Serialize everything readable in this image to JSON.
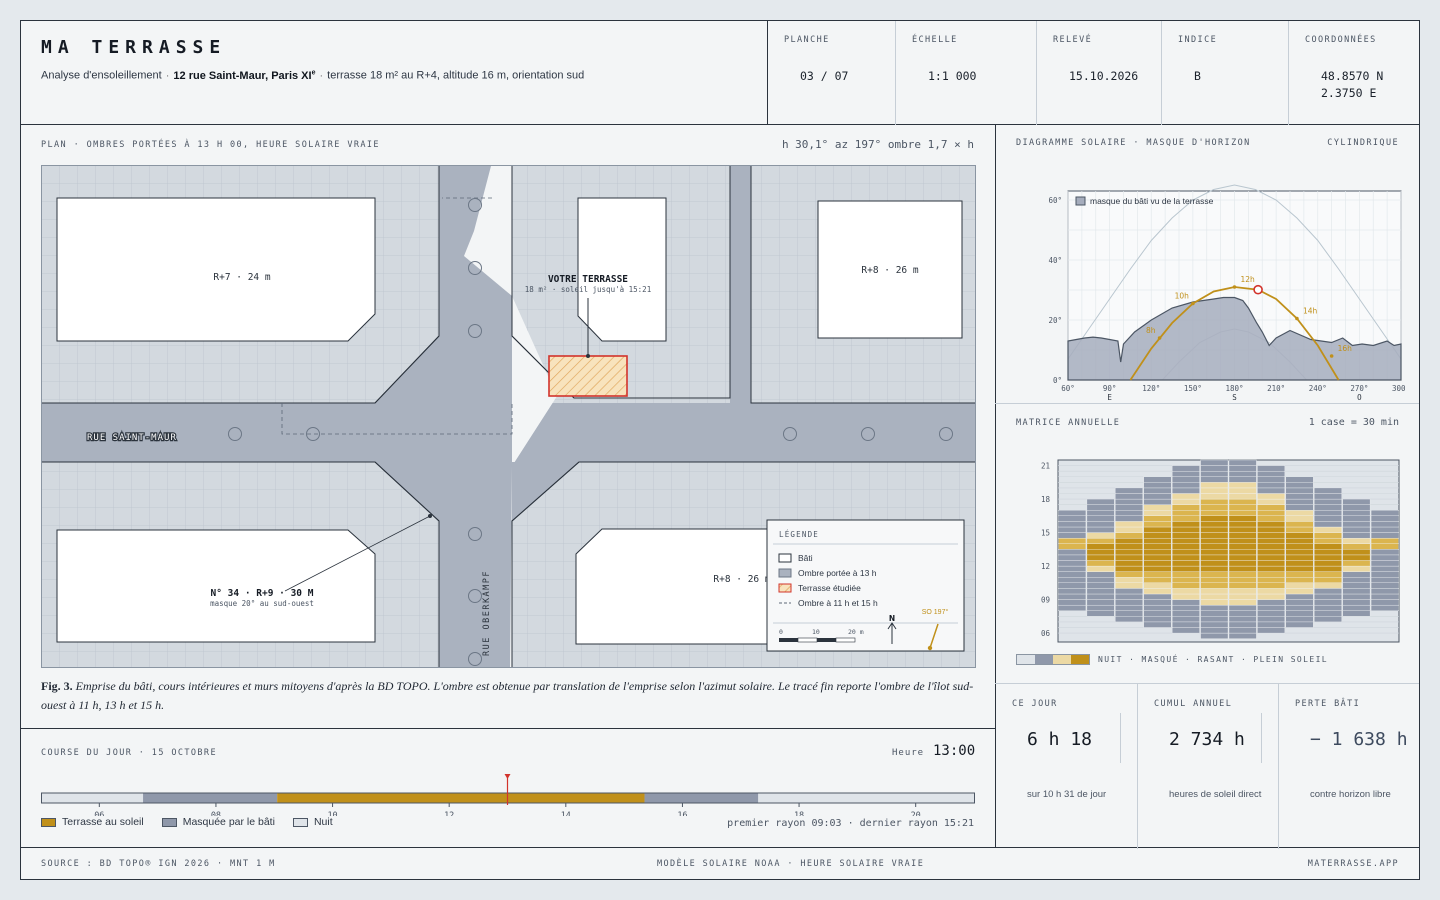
{
  "header": {
    "title": "MA TERRASSE",
    "subtitle_prefix": "Analyse d'ensoleillement",
    "address": "12 rue Saint-Maur, Paris XI",
    "address_sup": "e",
    "subtitle_suffix": "terrasse 18 m² au R+4, altitude 16 m, orientation sud",
    "meta": [
      {
        "label": "PLANCHE",
        "value": "03 / 07"
      },
      {
        "label": "ÉCHELLE",
        "value": "1:1 000"
      },
      {
        "label": "RELEVÉ",
        "value": "15.10.2026"
      },
      {
        "label": "INDICE",
        "value": "B"
      },
      {
        "label": "COORDONNÉES",
        "value": "48.8570 N\n2.3750 E"
      }
    ]
  },
  "plan": {
    "caption": "PLAN · OMBRES PORTÉES À 13 H 00, HEURE SOLAIRE VRAIE",
    "sun_readout": "h 30,1° az 197° ombre 1,7 × h",
    "street_h": "RUE SAINT-MAUR",
    "street_v": "RUE OBERKAMPF",
    "buildings": {
      "nw": "R+7 · 24 m",
      "ne": "R+8 · 26 m",
      "se": "R+8 · 26 m",
      "sw_title": "N° 34 · R+9 · 30 M",
      "sw_sub": "masque 20° au sud-ouest"
    },
    "terrace_title": "VOTRE TERRASSE",
    "terrace_sub": "18 m² · soleil jusqu'à 15:21",
    "legend": {
      "title": "LÉGENDE",
      "items": [
        "Bâti",
        "Ombre portée à 13 h",
        "Terrasse étudiée",
        "Ombre à 11 h et 15 h"
      ],
      "scale_ticks": [
        "0",
        "10",
        "20 m"
      ],
      "north": "N",
      "sun_dir": "SO 197°"
    },
    "fig_label": "Fig. 3.",
    "fig_text": "Emprise du bâti, cours intérieures et murs mitoyens d'après la BD TOPO. L'ombre est obtenue par translation de l'emprise selon l'azimut solaire. Le tracé fin reporte l'ombre de l'îlot sud-ouest à 11 h, 13 h et 15 h."
  },
  "course": {
    "caption": "COURSE DU JOUR · 15 OCTOBRE",
    "heure_label": "Heure",
    "heure_value": "13:00",
    "ticks": [
      "06",
      "08",
      "10",
      "12",
      "14",
      "16",
      "18",
      "20"
    ],
    "hour_range": [
      5,
      21
    ],
    "segments": [
      {
        "from": 5.0,
        "to": 6.75,
        "state": "nuit"
      },
      {
        "from": 6.75,
        "to": 9.05,
        "state": "masque"
      },
      {
        "from": 9.05,
        "to": 15.35,
        "state": "soleil"
      },
      {
        "from": 15.35,
        "to": 17.3,
        "state": "masque"
      },
      {
        "from": 17.3,
        "to": 21.0,
        "state": "nuit"
      }
    ],
    "cursor_hour": 13,
    "legend": [
      "Terrasse au soleil",
      "Masquée par le bâti",
      "Nuit"
    ],
    "rays": "premier rayon 09:03 · dernier rayon 15:21"
  },
  "solar": {
    "caption": "DIAGRAMME SOLAIRE · MASQUE D'HORIZON",
    "projection": "CYLINDRIQUE",
    "legend": "masque du bâti vu de la terrasse",
    "x_ticks": [
      "60°",
      "90°",
      "120°",
      "150°",
      "180°",
      "210°",
      "240°",
      "270°",
      "300°"
    ],
    "x_sub": {
      "90°": "E",
      "180°": "S",
      "270°": "O"
    },
    "y_ticks": [
      "0°",
      "20°",
      "40°",
      "60°"
    ],
    "hour_labels": [
      "8h",
      "10h",
      "12h",
      "14h",
      "16h"
    ],
    "mask_profile_az": [
      60,
      66,
      72,
      78,
      84,
      90,
      96,
      98,
      100,
      108,
      120,
      135,
      150,
      165,
      172,
      180,
      186,
      190,
      196,
      200,
      205,
      210,
      220,
      235,
      250,
      258,
      265,
      272,
      280,
      290,
      295,
      300
    ],
    "mask_profile_h": [
      13,
      13.5,
      14,
      14.3,
      14,
      13.5,
      13,
      6,
      12,
      16,
      20,
      24,
      26,
      27,
      27.5,
      27.5,
      26.5,
      24,
      19,
      16,
      11.5,
      14,
      16.5,
      13.5,
      12.5,
      14,
      11.5,
      12,
      11.5,
      13,
      11.5,
      12
    ],
    "sun_oct_az": [
      105,
      120,
      135,
      150,
      165,
      180,
      197,
      210,
      225,
      240,
      255
    ],
    "sun_oct_h": [
      0,
      10.5,
      19,
      25.5,
      29.5,
      31,
      30.1,
      27,
      20.5,
      11.5,
      0
    ],
    "sun_jun_az": [
      60,
      75,
      90,
      105,
      120,
      135,
      150,
      165,
      180,
      195,
      210,
      225,
      240,
      255,
      270,
      285,
      300
    ],
    "sun_jun_h": [
      7,
      17,
      27,
      37,
      46.5,
      54,
      60,
      63.5,
      65,
      63.5,
      60,
      54,
      46.5,
      37,
      27,
      17,
      7
    ],
    "sun_dec_az": [
      128,
      140,
      155,
      170,
      180,
      190,
      205,
      220,
      232
    ],
    "sun_dec_h": [
      0,
      6,
      12.5,
      16,
      17,
      16,
      12.5,
      6,
      0
    ]
  },
  "matrix": {
    "caption": "MATRICE ANNUELLE",
    "scale": "1 case = 30 min",
    "y_ticks": [
      "21",
      "18",
      "15",
      "12",
      "09",
      "06"
    ],
    "months": [
      "J",
      "F",
      "M",
      "A",
      "M",
      "J",
      "J",
      "A",
      "S",
      "O",
      "N",
      "D"
    ],
    "day_start": [
      8.0,
      7.5,
      7.0,
      6.5,
      6.0,
      5.5,
      5.5,
      6.0,
      6.5,
      7.0,
      7.5,
      8.0
    ],
    "day_end": [
      17.0,
      18.0,
      19.0,
      20.0,
      21.0,
      21.5,
      21.5,
      21.0,
      20.0,
      19.0,
      18.0,
      17.0
    ],
    "sun_start": [
      13.5,
      11.5,
      10.0,
      9.5,
      9.0,
      8.5,
      8.5,
      9.0,
      9.5,
      10.0,
      11.5,
      13.5
    ],
    "sun_end": [
      14.5,
      15.0,
      16.0,
      17.5,
      18.5,
      19.5,
      19.5,
      18.5,
      17.0,
      15.5,
      14.5,
      14.5
    ],
    "legend_label": "NUIT · MASQUÉ · RASANT · PLEIN SOLEIL"
  },
  "stats": [
    {
      "label": "CE JOUR",
      "value": "6 h 18",
      "note": "sur 10 h 31 de jour"
    },
    {
      "label": "CUMUL ANNUEL",
      "value": "2 734 h",
      "note": "heures de soleil direct"
    },
    {
      "label": "PERTE BÂTI",
      "value": "− 1 638 h",
      "note": "contre horizon libre"
    }
  ],
  "footer": {
    "left": "SOURCE : BD TOPO® IGN 2026 · MNT 1 M",
    "center": "MODÈLE SOLAIRE NOAA · HEURE SOLAIRE VRAIE",
    "right": "MATERRASSE.APP"
  },
  "colors": {
    "sun": "#c0901a",
    "sun_light": "#ecd9a4",
    "mask": "#8f98aa",
    "night": "#dfe4e9",
    "terrace": "#d2332c",
    "building": "#ffffff",
    "courtyard": "#d3d9df",
    "street": "#aab2bf"
  }
}
